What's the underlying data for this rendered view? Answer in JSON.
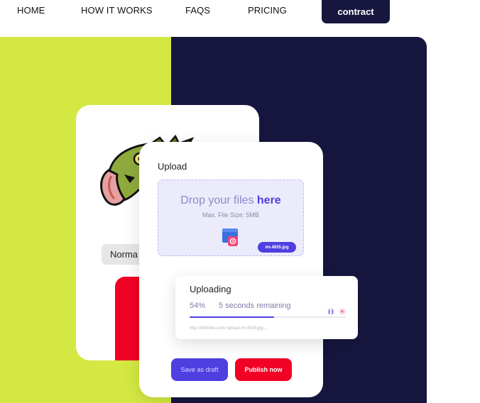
{
  "nav": {
    "items": [
      {
        "label": "HOME"
      },
      {
        "label": "HOW IT WORKS"
      },
      {
        "label": "FAQS"
      },
      {
        "label": "PRICING"
      }
    ],
    "cta_label": "contract"
  },
  "colors": {
    "lime": "#d3e842",
    "navy": "#17163f",
    "accent_purple": "#4f3fe0",
    "accent_red": "#f10225"
  },
  "back_card": {
    "chip_label": "Norma"
  },
  "upload": {
    "title": "Upload",
    "drop_text": "Drop your files ",
    "drop_text_strong": "here",
    "max_size": "Max. File Size: 5MB",
    "file_tag": "mr.4835.jpg",
    "icon": "image-file-icon"
  },
  "uploading": {
    "title": "Uploading",
    "percent": "54%",
    "progress_value": 0.54,
    "remaining": "5 seconds remaining",
    "url": "http://dribbble.com/ upload.mr.4835.jpg...."
  },
  "buttons": {
    "draft": "Save as draft",
    "publish": "Publish now"
  }
}
